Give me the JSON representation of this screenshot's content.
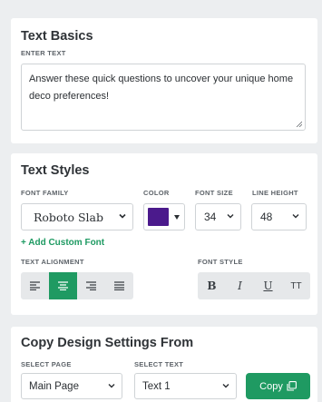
{
  "text_basics": {
    "title": "Text Basics",
    "enter_text_label": "ENTER TEXT",
    "text_value": "Answer these quick questions to uncover your unique home deco preferences!"
  },
  "text_styles": {
    "title": "Text Styles",
    "font_family_label": "FONT FAMILY",
    "font_family_value": "Roboto Slab",
    "color_label": "COLOR",
    "color_value": "#4b1a8c",
    "font_size_label": "FONT SIZE",
    "font_size_value": "34",
    "line_height_label": "LINE HEIGHT",
    "line_height_value": "48",
    "add_custom_font": "+ Add Custom Font",
    "text_alignment_label": "TEXT ALIGNMENT",
    "alignment_options": [
      "align-left-icon",
      "align-center-icon",
      "align-right-icon",
      "align-justify-icon"
    ],
    "active_alignment": "align-center-icon",
    "font_style_label": "FONT STYLE",
    "font_style_buttons": [
      "B",
      "I",
      "U",
      "TT"
    ]
  },
  "copy_design": {
    "title": "Copy Design Settings From",
    "select_page_label": "SELECT PAGE",
    "select_page_value": "Main Page",
    "select_text_label": "SELECT TEXT",
    "select_text_value": "Text 1",
    "copy_button_label": "Copy"
  },
  "colors": {
    "accent": "#1f9a62",
    "background": "#eceef0"
  }
}
